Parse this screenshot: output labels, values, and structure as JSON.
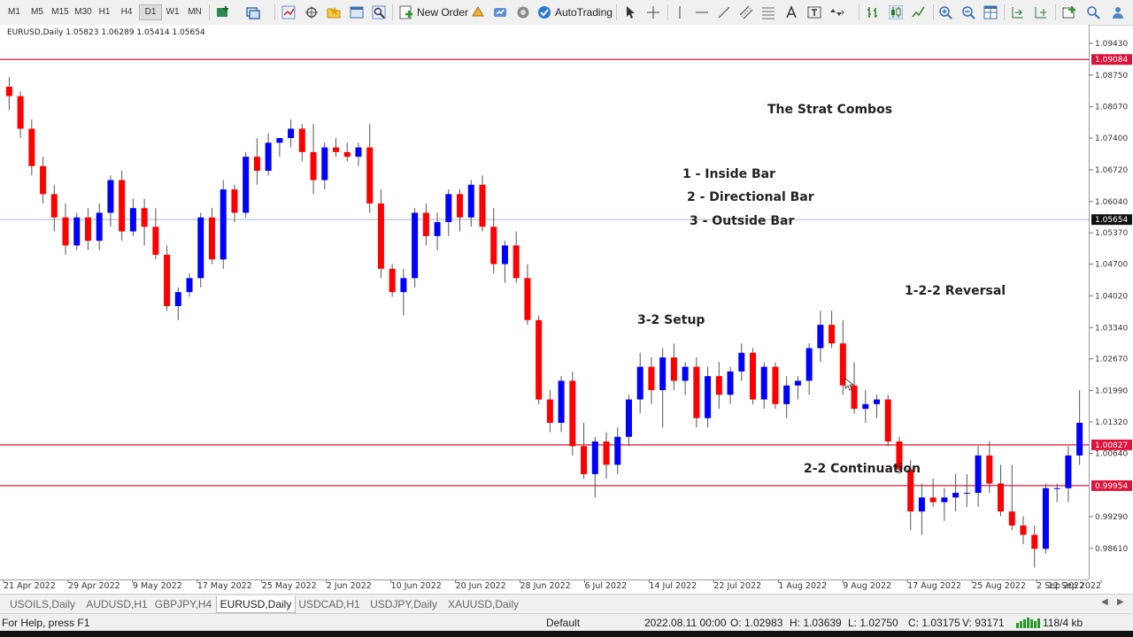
{
  "toolbar": {
    "timeframes": [
      "M1",
      "M5",
      "M15",
      "M30",
      "H1",
      "H4",
      "D1",
      "W1",
      "MN"
    ],
    "active_timeframe": "D1",
    "new_order_label": "New Order",
    "autotrading_label": "AutoTrading"
  },
  "chart": {
    "header": "EURUSD,Daily  1.05823 1.06289 1.05414 1.05654",
    "symbol": "EURUSD",
    "timeframe": "Daily",
    "ohlc": {
      "open": "1.05823",
      "high": "1.06289",
      "low": "1.05414",
      "close": "1.05654"
    },
    "bull_color": "#0000ff",
    "bear_color": "#ff0000",
    "level_color": "#dc143c",
    "bid_line_color": "#aab4cc",
    "price_axis": [
      "1.09430",
      "1.08750",
      "1.08070",
      "1.07400",
      "1.06720",
      "1.06040",
      "1.05370",
      "1.04700",
      "1.04020",
      "1.03340",
      "1.02670",
      "1.01990",
      "1.01320",
      "1.00640",
      "0.99290",
      "0.98610"
    ],
    "time_axis": [
      "21 Apr 2022",
      "29 Apr 2022",
      "9 May 2022",
      "17 May 2022",
      "25 May 2022",
      "2 Jun 2022",
      "10 Jun 2022",
      "20 Jun 2022",
      "28 Jun 2022",
      "6 Jul 2022",
      "14 Jul 2022",
      "22 Jul 2022",
      "1 Aug 2022",
      "9 Aug 2022",
      "17 Aug 2022",
      "25 Aug 2022",
      "2 Sep 2022",
      "12 Sep 2022"
    ],
    "levels": [
      {
        "price": 1.09084,
        "label": "1.09084"
      },
      {
        "price": 1.00827,
        "label": "1.00827"
      },
      {
        "price": 0.99954,
        "label": "0.99954"
      }
    ],
    "current_price": {
      "price": 1.05654,
      "label": "1.05654"
    },
    "annotations": {
      "title": "The Strat Combos",
      "inside_bar": "1 - Inside Bar",
      "directional_bar": "2 - Directional Bar",
      "outside_bar": "3 - Outside Bar",
      "setup_32": "3-2 Setup",
      "reversal_122": "1-2-2 Reversal",
      "continuation_22": "2-2 Continuation"
    }
  },
  "chart_data": {
    "type": "candlestick",
    "symbol": "EURUSD",
    "timeframe": "Daily",
    "ylim": [
      0.98,
      1.096
    ],
    "candles": [
      [
        1.085,
        1.087,
        1.08,
        1.083
      ],
      [
        1.083,
        1.084,
        1.074,
        1.076
      ],
      [
        1.076,
        1.078,
        1.066,
        1.068
      ],
      [
        1.068,
        1.07,
        1.06,
        1.062
      ],
      [
        1.062,
        1.064,
        1.054,
        1.057
      ],
      [
        1.057,
        1.06,
        1.049,
        1.051
      ],
      [
        1.051,
        1.058,
        1.05,
        1.057
      ],
      [
        1.057,
        1.059,
        1.05,
        1.052
      ],
      [
        1.052,
        1.06,
        1.05,
        1.058
      ],
      [
        1.058,
        1.066,
        1.055,
        1.065
      ],
      [
        1.065,
        1.067,
        1.052,
        1.054
      ],
      [
        1.054,
        1.061,
        1.053,
        1.059
      ],
      [
        1.059,
        1.061,
        1.051,
        1.055
      ],
      [
        1.055,
        1.059,
        1.048,
        1.049
      ],
      [
        1.049,
        1.051,
        1.037,
        1.038
      ],
      [
        1.038,
        1.042,
        1.035,
        1.041
      ],
      [
        1.041,
        1.045,
        1.04,
        1.044
      ],
      [
        1.044,
        1.058,
        1.042,
        1.057
      ],
      [
        1.057,
        1.059,
        1.047,
        1.048
      ],
      [
        1.048,
        1.065,
        1.046,
        1.063
      ],
      [
        1.063,
        1.064,
        1.056,
        1.058
      ],
      [
        1.058,
        1.071,
        1.057,
        1.07
      ],
      [
        1.07,
        1.074,
        1.064,
        1.067
      ],
      [
        1.067,
        1.075,
        1.066,
        1.073
      ],
      [
        1.073,
        1.074,
        1.07,
        1.074
      ],
      [
        1.074,
        1.078,
        1.072,
        1.076
      ],
      [
        1.076,
        1.077,
        1.069,
        1.071
      ],
      [
        1.071,
        1.077,
        1.062,
        1.065
      ],
      [
        1.065,
        1.073,
        1.063,
        1.072
      ],
      [
        1.072,
        1.074,
        1.07,
        1.071
      ],
      [
        1.071,
        1.073,
        1.069,
        1.07
      ],
      [
        1.07,
        1.073,
        1.068,
        1.072
      ],
      [
        1.072,
        1.077,
        1.058,
        1.06
      ],
      [
        1.06,
        1.063,
        1.044,
        1.046
      ],
      [
        1.046,
        1.047,
        1.04,
        1.041
      ],
      [
        1.041,
        1.046,
        1.036,
        1.044
      ],
      [
        1.044,
        1.059,
        1.042,
        1.058
      ],
      [
        1.058,
        1.06,
        1.051,
        1.053
      ],
      [
        1.053,
        1.058,
        1.05,
        1.056
      ],
      [
        1.056,
        1.063,
        1.053,
        1.062
      ],
      [
        1.062,
        1.063,
        1.054,
        1.057
      ],
      [
        1.057,
        1.065,
        1.055,
        1.064
      ],
      [
        1.064,
        1.066,
        1.054,
        1.055
      ],
      [
        1.055,
        1.059,
        1.045,
        1.047
      ],
      [
        1.047,
        1.052,
        1.043,
        1.051
      ],
      [
        1.051,
        1.054,
        1.043,
        1.044
      ],
      [
        1.044,
        1.047,
        1.034,
        1.035
      ],
      [
        1.035,
        1.036,
        1.017,
        1.018
      ],
      [
        1.018,
        1.02,
        1.011,
        1.013
      ],
      [
        1.013,
        1.023,
        1.011,
        1.022
      ],
      [
        1.022,
        1.024,
        1.006,
        1.008
      ],
      [
        1.008,
        1.013,
        1.001,
        1.002
      ],
      [
        1.002,
        1.01,
        0.997,
        1.009
      ],
      [
        1.009,
        1.011,
        1.001,
        1.004
      ],
      [
        1.004,
        1.012,
        1.002,
        1.01
      ],
      [
        1.01,
        1.019,
        1.008,
        1.018
      ],
      [
        1.018,
        1.028,
        1.015,
        1.025
      ],
      [
        1.025,
        1.027,
        1.017,
        1.02
      ],
      [
        1.02,
        1.029,
        1.012,
        1.027
      ],
      [
        1.027,
        1.03,
        1.02,
        1.022
      ],
      [
        1.022,
        1.026,
        1.019,
        1.025
      ],
      [
        1.025,
        1.027,
        1.012,
        1.014
      ],
      [
        1.014,
        1.025,
        1.012,
        1.023
      ],
      [
        1.023,
        1.026,
        1.016,
        1.019
      ],
      [
        1.019,
        1.025,
        1.017,
        1.024
      ],
      [
        1.024,
        1.03,
        1.022,
        1.028
      ],
      [
        1.028,
        1.029,
        1.017,
        1.018
      ],
      [
        1.018,
        1.026,
        1.016,
        1.025
      ],
      [
        1.025,
        1.026,
        1.016,
        1.017
      ],
      [
        1.017,
        1.023,
        1.014,
        1.021
      ],
      [
        1.021,
        1.023,
        1.018,
        1.022
      ],
      [
        1.022,
        1.03,
        1.019,
        1.029
      ],
      [
        1.029,
        1.037,
        1.026,
        1.034
      ],
      [
        1.034,
        1.037,
        1.029,
        1.03
      ],
      [
        1.03,
        1.035,
        1.019,
        1.021
      ],
      [
        1.021,
        1.026,
        1.015,
        1.016
      ],
      [
        1.016,
        1.02,
        1.013,
        1.017
      ],
      [
        1.017,
        1.019,
        1.014,
        1.018
      ],
      [
        1.018,
        1.019,
        1.008,
        1.009
      ],
      [
        1.009,
        1.01,
        1.002,
        1.003
      ],
      [
        1.003,
        1.005,
        0.99,
        0.994
      ],
      [
        0.994,
        1.0,
        0.989,
        0.997
      ],
      [
        0.997,
        1.001,
        0.995,
        0.996
      ],
      [
        0.996,
        0.999,
        0.992,
        0.997
      ],
      [
        0.997,
        1.002,
        0.994,
        0.998
      ],
      [
        0.998,
        1.002,
        0.995,
        0.998
      ],
      [
        0.998,
        1.008,
        0.995,
        1.006
      ],
      [
        1.006,
        1.009,
        0.998,
        1.0
      ],
      [
        1.0,
        1.004,
        0.993,
        0.994
      ],
      [
        0.994,
        1.004,
        0.99,
        0.991
      ],
      [
        0.991,
        0.993,
        0.987,
        0.989
      ],
      [
        0.989,
        0.991,
        0.982,
        0.986
      ],
      [
        0.986,
        1.0,
        0.985,
        0.999
      ],
      [
        0.999,
        1.0,
        0.996,
        0.999
      ],
      [
        0.999,
        1.008,
        0.996,
        1.006
      ],
      [
        1.006,
        1.02,
        1.004,
        1.013
      ]
    ],
    "xlabels": [
      "21 Apr 2022",
      "29 Apr 2022",
      "9 May 2022",
      "17 May 2022",
      "25 May 2022",
      "2 Jun 2022",
      "10 Jun 2022",
      "20 Jun 2022",
      "28 Jun 2022",
      "6 Jul 2022",
      "14 Jul 2022",
      "22 Jul 2022",
      "1 Aug 2022",
      "9 Aug 2022",
      "17 Aug 2022",
      "25 Aug 2022",
      "2 Sep 2022",
      "12 Sep 2022"
    ]
  },
  "tabs": [
    {
      "label": "USOILS,Daily",
      "active": false
    },
    {
      "label": "AUDUSD,H1",
      "active": false
    },
    {
      "label": "GBPJPY,H4",
      "active": false
    },
    {
      "label": "EURUSD,Daily",
      "active": true
    },
    {
      "label": "USDCAD,H1",
      "active": false
    },
    {
      "label": "USDJPY,Daily",
      "active": false
    },
    {
      "label": "XAUUSD,Daily",
      "active": false
    }
  ],
  "status": {
    "help": "For Help, press F1",
    "profile": "Default",
    "datetime": "2022.08.11 00:00",
    "open": "O: 1.02983",
    "high": "H: 1.03639",
    "low": "L: 1.02750",
    "close": "C: 1.03175",
    "volume": "V: 93171",
    "traffic": "118/4 kb"
  }
}
